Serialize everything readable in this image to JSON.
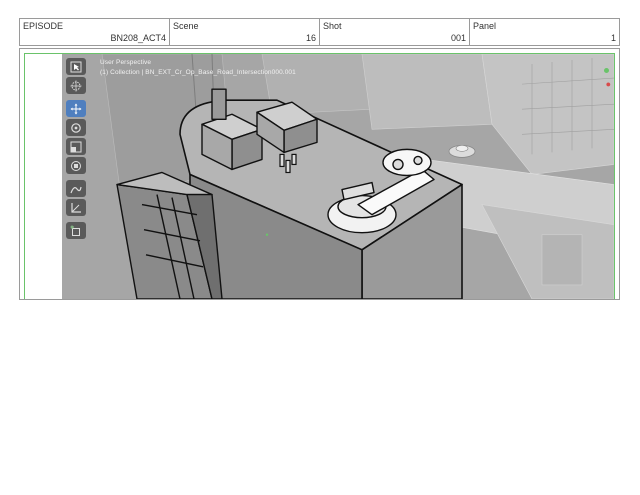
{
  "header": {
    "episode_label": "EPISODE",
    "episode_value": "BN208_ACT4",
    "scene_label": "Scene",
    "scene_value": "16",
    "shot_label": "Shot",
    "shot_value": "001",
    "panel_label": "Panel",
    "panel_value": "1"
  },
  "viewport": {
    "perspective_label": "User Perspective",
    "collection_label": "(1) Collection | BN_EXT_Cr_Op_Base_Road_Intersection000.001"
  },
  "toolbar": {
    "tools": [
      {
        "icon": "select-cursor-icon"
      },
      {
        "icon": "cursor-icon"
      },
      {
        "icon": "move-icon",
        "active": true
      },
      {
        "icon": "rotate-icon"
      },
      {
        "icon": "scale-icon"
      },
      {
        "icon": "transform-icon"
      },
      {
        "icon": "annotate-icon"
      },
      {
        "icon": "measure-icon"
      },
      {
        "icon": "add-cube-icon"
      }
    ]
  },
  "colors": {
    "frame_border": "#9a9a9a",
    "viewport_border": "#6ac36a",
    "tool_bg": "#5a5a5a",
    "tool_active": "#4f7fbf",
    "scene_bg": "#a9a9a9"
  }
}
